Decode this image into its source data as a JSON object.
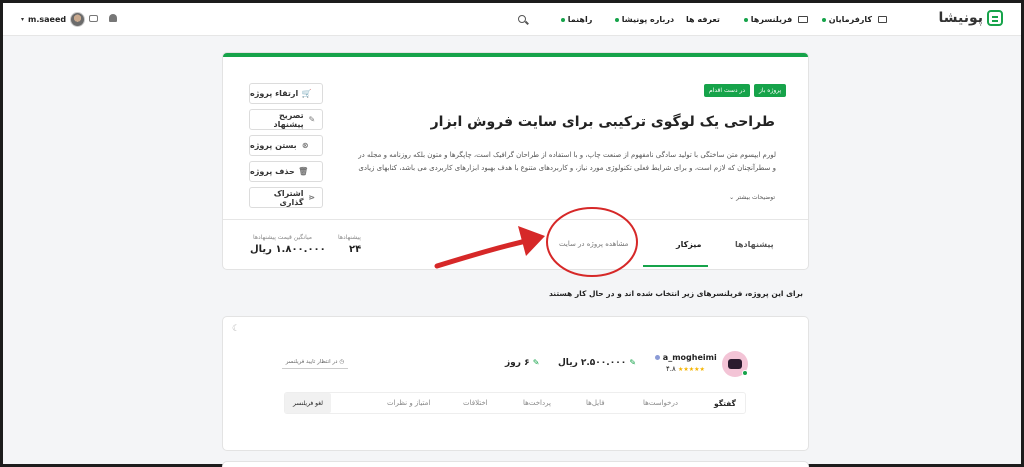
{
  "header": {
    "logo_text": "پونیشا",
    "nav": [
      {
        "label": "کارفرمایان",
        "icon": "briefcase-icon",
        "has_dropdown": true
      },
      {
        "label": "فریلنسرها",
        "icon": "monitor-icon",
        "has_dropdown": true
      },
      {
        "label": "تعرفه ها",
        "has_dropdown": false
      },
      {
        "label": "درباره پونیشا",
        "has_dropdown": true
      },
      {
        "label": "راهنما",
        "has_dropdown": true
      }
    ],
    "user_name": "m.saeed"
  },
  "project": {
    "badges": [
      "پروژه باز",
      "در دست اقدام"
    ],
    "title": "طراحی یک لوگوی ترکیبی برای سایت فروش ابزار",
    "description_lines": [
      "لورم ایپسوم متن ساختگی با تولید سادگی نامفهوم از صنعت چاپ، و با استفاده از طراحان گرافیک است، چاپگرها و متون بلکه روزنامه و مجله در ستون",
      "و سطرآنچنان که لازم است، و برای شرایط فعلی تکنولوژی مورد نیاز، و کاربردهای متنوع با هدف بهبود ابزارهای کاربردی می باشد، کتابهای زیادی در"
    ],
    "more_label": "توضیحات بیشتر",
    "actions": [
      {
        "label": "ارتقاء پروژه",
        "icon": "cart-icon"
      },
      {
        "label": "تصریح پیشنهاد",
        "icon": "pencil-icon"
      },
      {
        "label": "بستن پروژه",
        "icon": "close-circle-icon"
      },
      {
        "label": "حذف پروژه",
        "icon": "trash-icon"
      },
      {
        "label": "اشتراک گذاری",
        "icon": "share-icon"
      }
    ],
    "tabs": [
      "پیشنهادها",
      "میزکار",
      "مشاهده پروژه در سایت"
    ],
    "active_tab": "میزکار",
    "stats": [
      {
        "label": "پیشنهادها",
        "value": "۲۴"
      },
      {
        "label": "میانگین قیمت پیشنهادها",
        "value": "۱.۸۰۰.۰۰۰ ریال"
      }
    ]
  },
  "notice": "برای این پروژه، فریلنسرهای زیر انتخاب شده اند و در حال کار هستند",
  "freelancer": {
    "username": "a_mogheimi",
    "rating": "۴.۸",
    "stars": 5,
    "price": "۲.۵۰۰.۰۰۰ ریال",
    "duration": "۶ روز",
    "status": "در انتظار تایید فریلنسر",
    "tabs": [
      "گفتگو",
      "درخواست‌ها",
      "فایل‌ها",
      "پرداخت‌ها",
      "اختلافات",
      "امتیاز و نظرات"
    ],
    "cancel_label": "لغو فریلنسر"
  },
  "colors": {
    "accent": "#16a34a",
    "annotation": "#d62828"
  }
}
